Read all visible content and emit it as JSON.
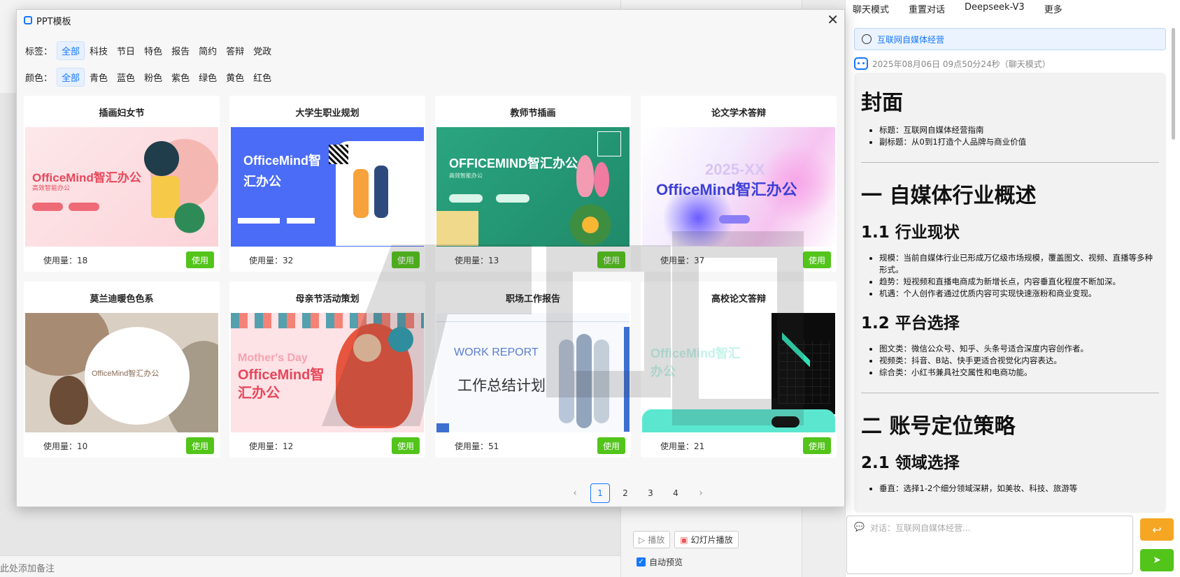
{
  "background": {
    "note_placeholder": "此处添加备注",
    "play_label": "播放",
    "slideshow_label": "幻灯片播放",
    "auto_preview_label": "自动预览"
  },
  "chat": {
    "menu": [
      "聊天模式",
      "重置对话",
      "Deepseek-V3",
      "更多"
    ],
    "topic": "互联网自媒体经营",
    "timestamp": "2025年08月06日 09点50分24秒（聊天模式）",
    "doc": {
      "cover_heading": "封面",
      "cover_items": [
        "标题：互联网自媒体经营指南",
        "副标题：从0到1打造个人品牌与商业价值"
      ],
      "section1": "一 自媒体行业概述",
      "s11": "1.1 行业现状",
      "s11_items": [
        "规模：当前自媒体行业已形成万亿级市场规模，覆盖图文、视频、直播等多种形式。",
        "趋势：短视频和直播电商成为新增长点，内容垂直化程度不断加深。",
        "机遇：个人创作者通过优质内容可实现快速涨粉和商业变现。"
      ],
      "s12": "1.2 平台选择",
      "s12_items": [
        "图文类：微信公众号、知乎、头条号适合深度内容创作者。",
        "视频类：抖音、B站、快手更适合视觉化内容表达。",
        "综合类：小红书兼具社交属性和电商功能。"
      ],
      "section2": "二 账号定位策略",
      "s21": "2.1 领域选择",
      "s21_partial": "垂直：选择1-2个细分领域深耕，如美妆、科技、旅游等"
    },
    "input_placeholder": "对话：互联网自媒体经营..."
  },
  "modal": {
    "title": "PPT模板",
    "tag_label": "标签：",
    "tags": [
      "全部",
      "科技",
      "节日",
      "特色",
      "报告",
      "简约",
      "答辩",
      "党政"
    ],
    "color_label": "颜色：",
    "colors": [
      "全部",
      "青色",
      "蓝色",
      "粉色",
      "紫色",
      "绿色",
      "黄色",
      "红色"
    ],
    "use_label": "使用",
    "usage_prefix": "使用量：",
    "templates": [
      {
        "title": "插画妇女节",
        "usage": "使用量：18",
        "thumb_text": "OfficeMind智汇办公",
        "sub": "高效智能办公"
      },
      {
        "title": "大学生职业规划",
        "usage": "使用量：32",
        "thumb_text": "OfficeMind智",
        "thumb_text2": "汇办公"
      },
      {
        "title": "教师节插画",
        "usage": "使用量：13",
        "thumb_text": "OFFICEMIND智汇办公",
        "sub": "高效智能办公"
      },
      {
        "title": "论文学术答辩",
        "usage": "使用量：37",
        "thumb_text": "OfficeMind智汇办公",
        "sub": "2025-XX"
      },
      {
        "title": "莫兰迪暖色色系",
        "usage": "使用量：10",
        "thumb_text": "OfficeMind智汇办公"
      },
      {
        "title": "母亲节活动策划",
        "usage": "使用量：12",
        "thumb_text": "OfficeMind智",
        "thumb_text2": "汇办公",
        "sub": "Mother's Day"
      },
      {
        "title": "职场工作报告",
        "usage": "使用量：51",
        "thumb_text": "工作总结计划",
        "sub": "WORK REPORT"
      },
      {
        "title": "高校论文答辩",
        "usage": "使用量：21",
        "thumb_text": "OfficeMind智汇",
        "thumb_text2": "办公"
      }
    ],
    "pages": [
      "1",
      "2",
      "3",
      "4"
    ],
    "current_page": "1"
  },
  "colors": {
    "primary": "#1677ff",
    "success": "#52c41a",
    "warning": "#f5a623"
  }
}
